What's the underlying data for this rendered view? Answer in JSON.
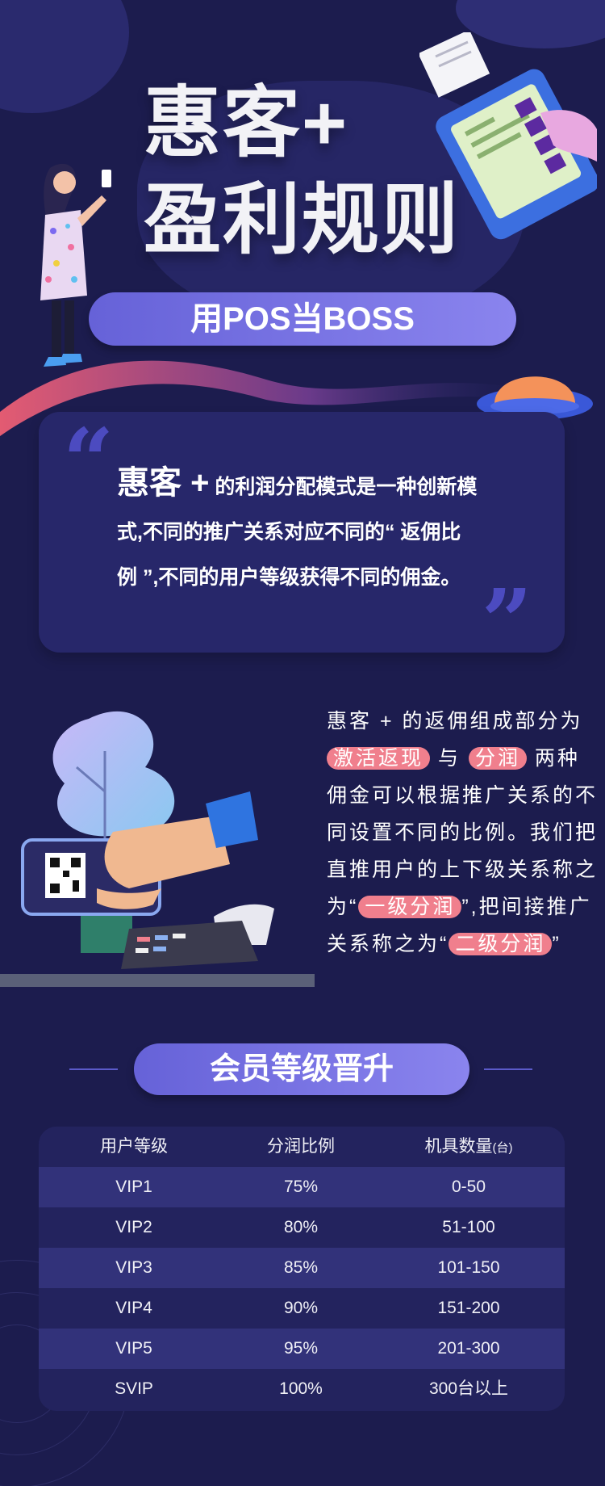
{
  "header": {
    "title_line1": "惠客+",
    "title_line2": "盈利规则",
    "subtitle": "用POS当BOSS"
  },
  "quote": {
    "brand": "惠客 +",
    "text_line1": " 的利润分配模式是一种创新模",
    "text_line2": "式,不同的推广关系对应不同的“ 返佣比",
    "text_line3": "例 ”,不同的用户等级获得不同的佣金。"
  },
  "description": {
    "p1": "惠客 + 的返佣组成部分为",
    "hl1": "激活返现",
    "p2": "与",
    "hl2": "分润",
    "p3": "两种佣金可以根据推广关系的不同设置不同的比例。我们把直推用户的上下级关系称之为“",
    "hl3": "一级分润",
    "p4": "”,把间接推广关系称之为“",
    "hl4": "二级分润",
    "p5": "”"
  },
  "section": {
    "title": "会员等级晋升"
  },
  "table": {
    "headers": [
      "用户等级",
      "分润比例",
      "机具数量"
    ],
    "unit": "(台)",
    "rows": [
      [
        "VIP1",
        "75%",
        "0-50"
      ],
      [
        "VIP2",
        "80%",
        "51-100"
      ],
      [
        "VIP3",
        "85%",
        "101-150"
      ],
      [
        "VIP4",
        "90%",
        "151-200"
      ],
      [
        "VIP5",
        "95%",
        "201-300"
      ],
      [
        "SVIP",
        "100%",
        "300台以上"
      ]
    ]
  },
  "colors": {
    "background": "#1c1c4e",
    "accent_purple": "#6662d8",
    "highlight_pink": "#f07f8d"
  }
}
